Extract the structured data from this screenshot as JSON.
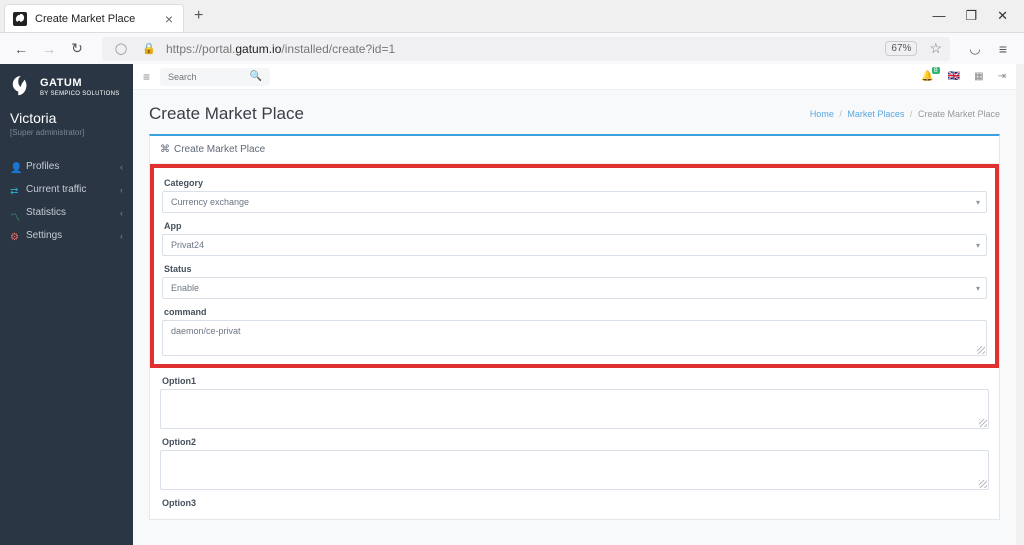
{
  "browser": {
    "tab_title": "Create Market Place",
    "url_pre": "https://portal.",
    "url_domain": "gatum.io",
    "url_path": "/installed/create?id=1",
    "zoom": "67%"
  },
  "brand": {
    "name": "GATUM",
    "sub": "BY SEMPICO SOLUTIONS"
  },
  "user": {
    "name": "Victoria",
    "role": "[Super administrator]"
  },
  "sidebar": {
    "profiles": "Profiles",
    "traffic": "Current traffic",
    "stats": "Statistics",
    "settings": "Settings"
  },
  "topbar": {
    "search_placeholder": "Search",
    "notif": "8"
  },
  "page": {
    "title": "Create Market Place",
    "panel_title": "Create Market Place",
    "crumb_home": "Home",
    "crumb_mp": "Market Places",
    "crumb_current": "Create Market Place"
  },
  "form": {
    "category_label": "Category",
    "category_value": "Currency exchange",
    "app_label": "App",
    "app_value": "Privat24",
    "status_label": "Status",
    "status_value": "Enable",
    "command_label": "command",
    "command_value": "daemon/ce-privat",
    "option1_label": "Option1",
    "option2_label": "Option2",
    "option3_label": "Option3"
  }
}
